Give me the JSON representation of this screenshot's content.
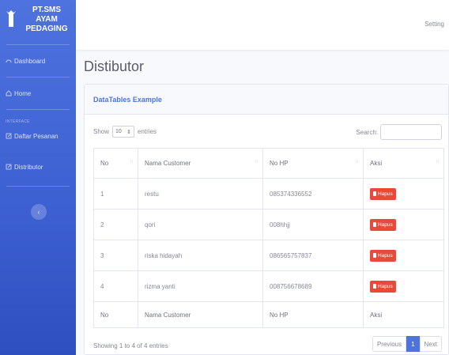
{
  "brand": {
    "line1": "PT.SMS AYAM",
    "line2": "PEDAGING"
  },
  "sidebar": {
    "items_top": [
      {
        "label": "Dashboard"
      },
      {
        "label": "Home"
      }
    ],
    "heading": "INTERFACE",
    "items_bottom": [
      {
        "label": "Daftar Pesanan"
      },
      {
        "label": "Distributor"
      }
    ],
    "toggle_icon": "‹"
  },
  "topbar": {
    "user_label": "Setting"
  },
  "page_title": "Distibutor",
  "card": {
    "header": "DataTables Example",
    "length": {
      "prefix": "Show",
      "value": "10",
      "suffix": "entries"
    },
    "search": {
      "label": "Search:",
      "value": ""
    },
    "columns": [
      "No",
      "Nama Customer",
      "No HP",
      "Aksi"
    ],
    "rows": [
      {
        "no": "1",
        "name": "restu",
        "hp": "085374336552",
        "action": "Hapus"
      },
      {
        "no": "2",
        "name": "qori",
        "hp": "008hhjj",
        "action": "Hapus"
      },
      {
        "no": "3",
        "name": "riska hidayah",
        "hp": "086565757837",
        "action": "Hapus"
      },
      {
        "no": "4",
        "name": "rizma yanti",
        "hp": "008756678689",
        "action": "Hapus"
      }
    ],
    "footer_columns": [
      "No",
      "Nama Customer",
      "No HP",
      "Aksi"
    ],
    "info": "Showing 1 to 4 of 4 entries",
    "pagination": {
      "previous": "Previous",
      "current": "1",
      "next": "Next"
    }
  },
  "colors": {
    "primary": "#4e73df",
    "danger": "#e74a3b",
    "text_muted": "#858796"
  }
}
